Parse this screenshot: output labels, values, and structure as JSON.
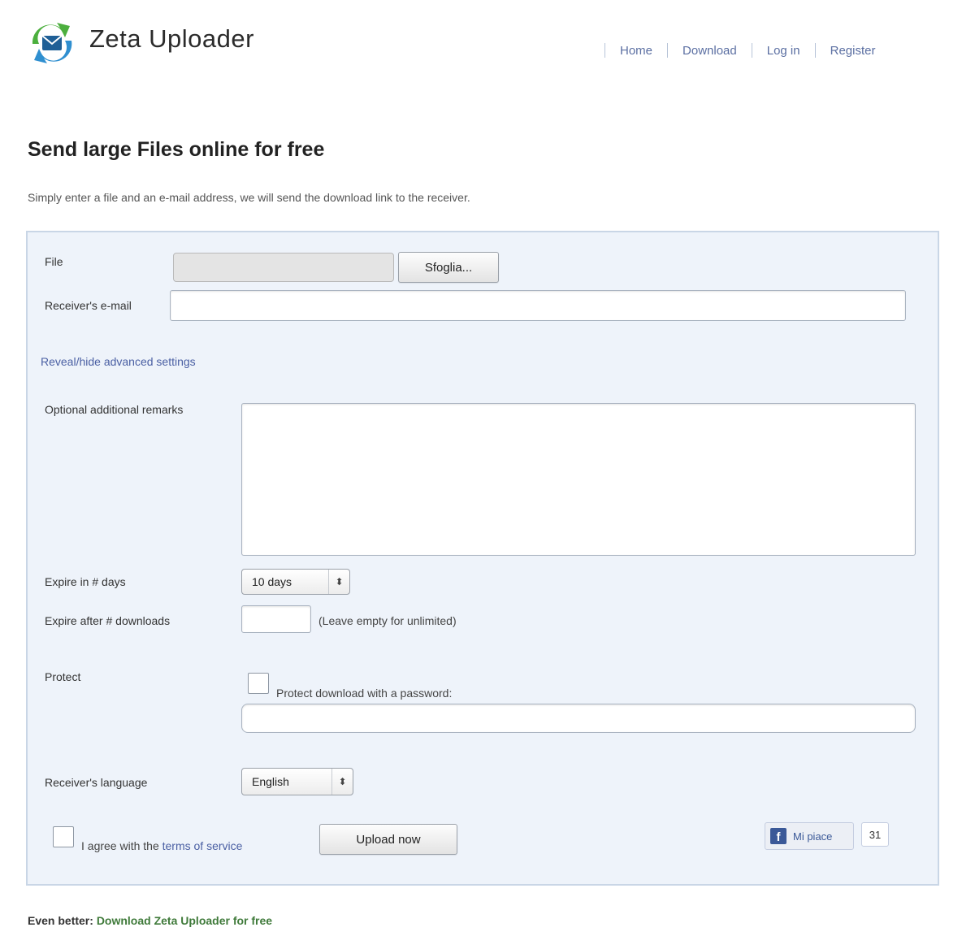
{
  "header": {
    "title": "Zeta Uploader",
    "nav": [
      "Home",
      "Download",
      "Log in",
      "Register"
    ]
  },
  "headline": "Send large Files online for free",
  "intro": "Simply enter a file and an e-mail address, we will send the download link to the receiver.",
  "form": {
    "file_label": "File",
    "choose_button": "Sfoglia...",
    "email_label": "Receiver's e-mail",
    "email_value": "",
    "advanced_link": "Reveal/hide advanced settings",
    "remarks_label": "Optional additional remarks",
    "remarks_value": "",
    "expires_days_label": "Expire in # days",
    "expires_days_value": "10 days",
    "expires_downloads_label": "Expire after # downloads",
    "expires_downloads_value": "",
    "expires_downloads_hint": "(Leave empty for unlimited)",
    "protect_label": "Protect",
    "protect_text": "Protect download with a password:",
    "password_value": "",
    "language_label": "Receiver's language",
    "language_value": "English",
    "agree_prefix": "I agree with the",
    "terms_link": "terms of service",
    "upload_button": "Upload now"
  },
  "social": {
    "like_label": "Mi piace",
    "like_count": "31"
  },
  "footer": {
    "prefix": "Even better:",
    "link": "Download Zeta Uploader for free"
  },
  "colors": {
    "panel_bg": "#eef3fa",
    "panel_border": "#c9d6e6",
    "link": "#4a5fa3",
    "footer_link": "#3f7a3a"
  }
}
